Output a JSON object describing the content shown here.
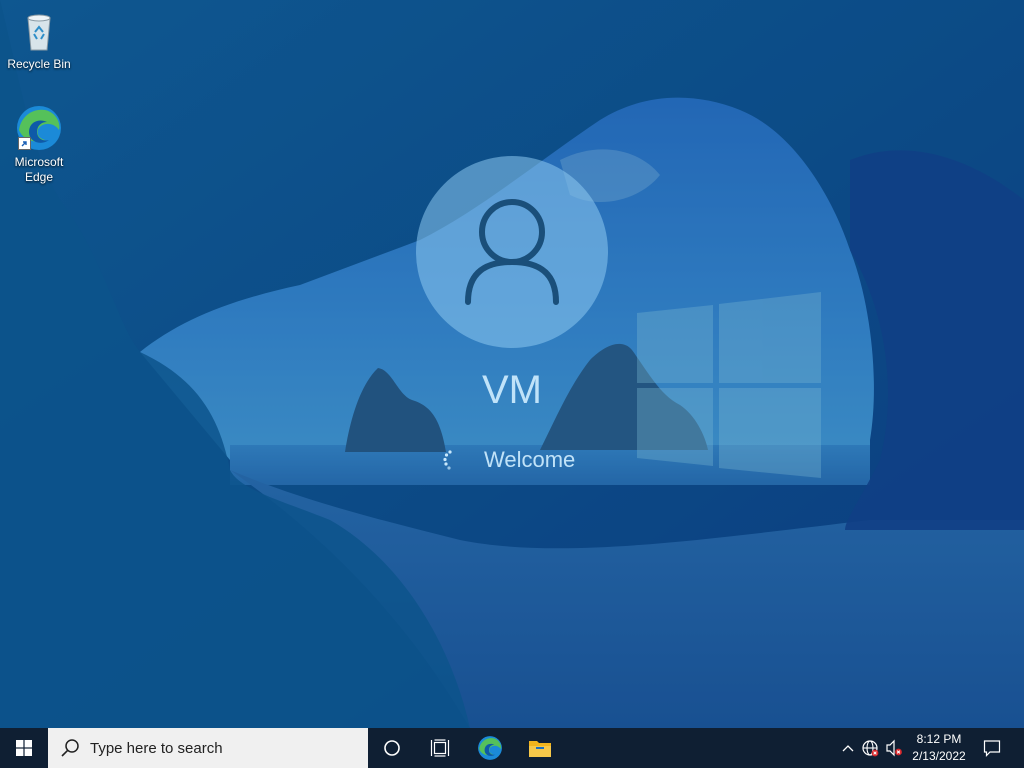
{
  "desktop": {
    "icons": [
      {
        "label": "Recycle Bin",
        "icon": "recycle-bin-icon"
      },
      {
        "label": "Microsoft Edge",
        "icon": "edge-icon"
      }
    ]
  },
  "welcome": {
    "user_name": "VM",
    "status": "Welcome"
  },
  "taskbar": {
    "search_placeholder": "Type here to search",
    "clock_time": "8:12 PM",
    "clock_date": "2/13/2022"
  },
  "colors": {
    "taskbar_bg": "#0f1f33",
    "search_bg": "#f0f0f0",
    "edge_blue": "#1b8ad8",
    "edge_green": "#55c15a",
    "folder_yellow": "#f1b41e",
    "overlay_blue": "#0b4a86"
  }
}
